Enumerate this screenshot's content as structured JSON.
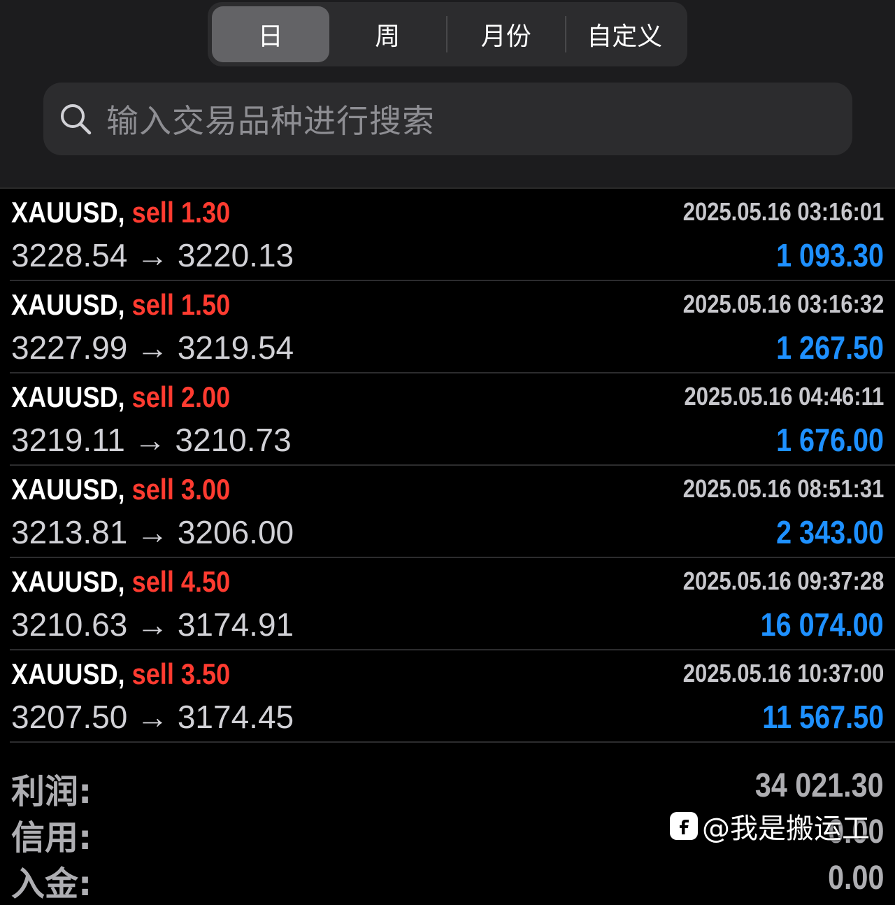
{
  "tabs": [
    {
      "label": "日",
      "active": true
    },
    {
      "label": "周",
      "active": false
    },
    {
      "label": "月份",
      "active": false
    },
    {
      "label": "自定义",
      "active": false
    }
  ],
  "search": {
    "placeholder": "输入交易品种进行搜索"
  },
  "trades": [
    {
      "symbol": "XAUUSD,",
      "side": "sell",
      "volume": "1.30",
      "time": "2025.05.16 03:16:01",
      "prices": "3228.54 → 3220.13",
      "profit": "1 093.30"
    },
    {
      "symbol": "XAUUSD,",
      "side": "sell",
      "volume": "1.50",
      "time": "2025.05.16 03:16:32",
      "prices": "3227.99 → 3219.54",
      "profit": "1 267.50"
    },
    {
      "symbol": "XAUUSD,",
      "side": "sell",
      "volume": "2.00",
      "time": "2025.05.16 04:46:11",
      "prices": "3219.11 → 3210.73",
      "profit": "1 676.00"
    },
    {
      "symbol": "XAUUSD,",
      "side": "sell",
      "volume": "3.00",
      "time": "2025.05.16 08:51:31",
      "prices": "3213.81 → 3206.00",
      "profit": "2 343.00"
    },
    {
      "symbol": "XAUUSD,",
      "side": "sell",
      "volume": "4.50",
      "time": "2025.05.16 09:37:28",
      "prices": "3210.63 → 3174.91",
      "profit": "16 074.00"
    },
    {
      "symbol": "XAUUSD,",
      "side": "sell",
      "volume": "3.50",
      "time": "2025.05.16 10:37:00",
      "prices": "3207.50 → 3174.45",
      "profit": "11 567.50"
    }
  ],
  "summary": [
    {
      "label": "利润:",
      "value": "34 021.30"
    },
    {
      "label": "信用:",
      "value": "0.00"
    },
    {
      "label": "入金:",
      "value": "0.00"
    }
  ],
  "watermark": {
    "text": "@我是搬运工"
  },
  "colors": {
    "sell": "#ff3b30",
    "profit": "#1e90ff",
    "background": "#000000"
  }
}
